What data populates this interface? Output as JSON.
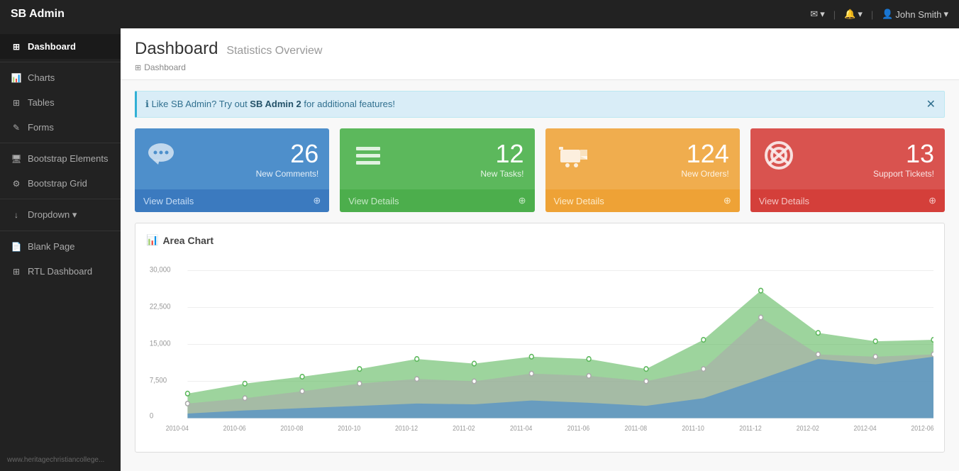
{
  "app": {
    "brand": "SB Admin"
  },
  "navbar": {
    "mail_label": "✉",
    "bell_label": "🔔",
    "user_label": "John Smith",
    "dropdown_caret": "▾"
  },
  "sidebar": {
    "items": [
      {
        "id": "dashboard",
        "icon": "⊞",
        "label": "Dashboard",
        "active": true
      },
      {
        "id": "charts",
        "icon": "📊",
        "label": "Charts",
        "active": false
      },
      {
        "id": "tables",
        "icon": "⊞",
        "label": "Tables",
        "active": false
      },
      {
        "id": "forms",
        "icon": "✎",
        "label": "Forms",
        "active": false
      },
      {
        "id": "bootstrap-elements",
        "icon": "🖥",
        "label": "Bootstrap Elements",
        "active": false
      },
      {
        "id": "bootstrap-grid",
        "icon": "⚙",
        "label": "Bootstrap Grid",
        "active": false
      },
      {
        "id": "dropdown",
        "icon": "▼",
        "label": "Dropdown ▾",
        "active": false
      },
      {
        "id": "blank-page",
        "icon": "📄",
        "label": "Blank Page",
        "active": false
      },
      {
        "id": "rtl-dashboard",
        "icon": "⊞",
        "label": "RTL Dashboard",
        "active": false
      }
    ],
    "footer_text": "www.heritagechristiancollege..."
  },
  "page": {
    "title": "Dashboard",
    "subtitle": "Statistics Overview",
    "breadcrumb_icon": "⊞",
    "breadcrumb_label": "Dashboard"
  },
  "alert": {
    "icon": "ℹ",
    "text_before": "Like SB Admin? Try out ",
    "link_text": "SB Admin 2",
    "text_after": " for additional features!"
  },
  "cards": [
    {
      "id": "comments",
      "color_class": "card-blue",
      "icon": "💬",
      "number": "26",
      "label": "New Comments!",
      "footer": "View Details",
      "footer_icon": "⊕"
    },
    {
      "id": "tasks",
      "color_class": "card-green",
      "icon": "≡",
      "number": "12",
      "label": "New Tasks!",
      "footer": "View Details",
      "footer_icon": "⊕"
    },
    {
      "id": "orders",
      "color_class": "card-orange",
      "icon": "🛒",
      "number": "124",
      "label": "New Orders!",
      "footer": "View Details",
      "footer_icon": "⊕"
    },
    {
      "id": "tickets",
      "color_class": "card-red",
      "icon": "⊙",
      "number": "13",
      "label": "Support Tickets!",
      "footer": "View Details",
      "footer_icon": "⊕"
    }
  ],
  "chart": {
    "title": "Area Chart",
    "icon": "📊",
    "x_labels": [
      "2010-04",
      "2010-06",
      "2010-08",
      "2010-10",
      "2010-12",
      "2011-02",
      "2011-04",
      "2011-06",
      "2011-08",
      "2011-10",
      "2011-12",
      "2012-02",
      "2012-04",
      "2012-06"
    ],
    "y_labels": [
      "0",
      "7,500",
      "15,000",
      "22,500",
      "30,000"
    ],
    "series": {
      "green": {
        "color": "#5cb85c",
        "opacity": "0.6",
        "points": [
          5000,
          7000,
          8500,
          10000,
          12000,
          11000,
          12500,
          12000,
          10000,
          16000,
          26000,
          17000,
          15500,
          16000
        ]
      },
      "gray": {
        "color": "#aaa",
        "opacity": "0.6",
        "points": [
          3000,
          4000,
          5500,
          7000,
          8000,
          7500,
          9000,
          8500,
          7000,
          10000,
          20500,
          13000,
          12500,
          13000
        ]
      },
      "blue": {
        "color": "#4e8fcb",
        "opacity": "0.7",
        "points": [
          1000,
          1500,
          2000,
          2500,
          3000,
          2800,
          3500,
          3200,
          2500,
          4000,
          8000,
          12000,
          11000,
          12500
        ]
      }
    }
  }
}
